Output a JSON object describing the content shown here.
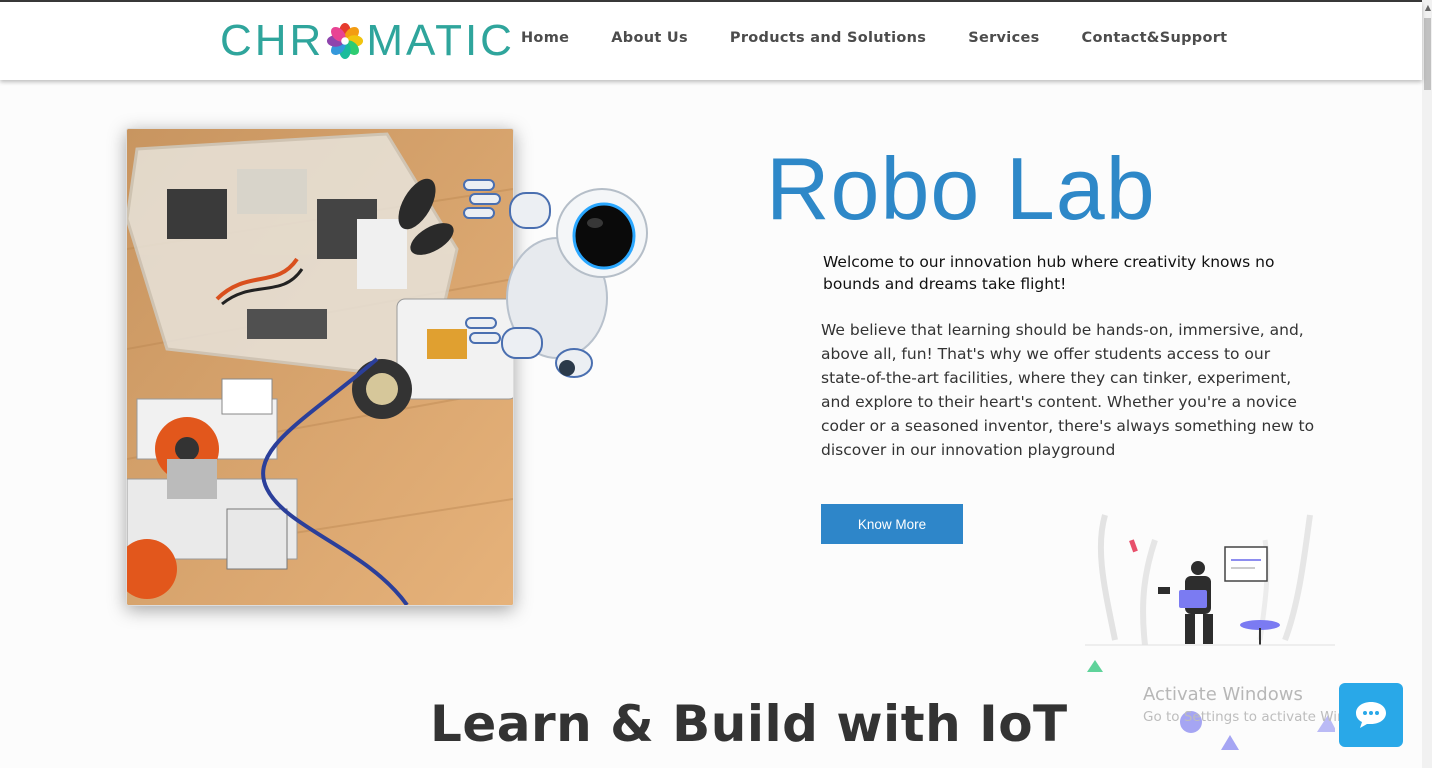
{
  "header": {
    "logo_left": "CHR",
    "logo_right": "MATIC",
    "logo_color": "#2fa59c",
    "nav": [
      "Home",
      "About Us",
      "Products and Solutions",
      "Services",
      "Contact&Support"
    ]
  },
  "hero": {
    "title": "Robo Lab",
    "title_color": "#2e88c8",
    "lead": "Welcome to our innovation hub where creativity knows no bounds and dreams take flight!",
    "body": "We believe that learning should be hands-on, immersive, and, above all, fun! That's why we offer students access to our state-of-the-art facilities, where they can tinker, experiment, and explore to their heart's content. Whether you're a novice coder or a seasoned inventor, there's always something new to discover in our innovation playground",
    "button_label": "Know More",
    "button_color": "#2e86c9"
  },
  "section": {
    "title": "Learn & Build with IoT"
  },
  "os_overlay": {
    "line1": "Activate Windows",
    "line2": "Go to Settings to activate Windows."
  },
  "chat": {
    "icon": "chat-bubble-icon",
    "color": "#29a8e8"
  }
}
